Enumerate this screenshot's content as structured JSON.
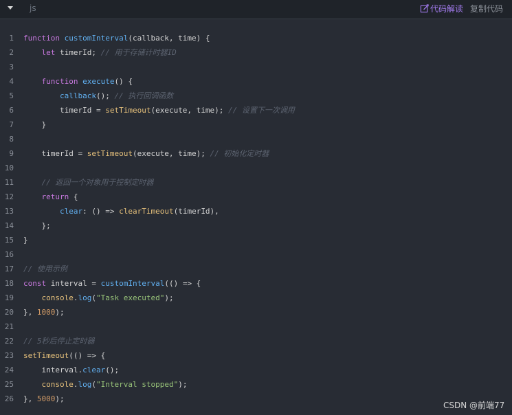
{
  "header": {
    "lang": "js",
    "explain_label": "代码解读",
    "copy_label": "复制代码",
    "icons": {
      "collapse": "caret-down-icon",
      "explain": "edit-icon"
    },
    "colors": {
      "accent": "#a47cf0",
      "background": "#282c34"
    }
  },
  "code": {
    "lines": [
      {
        "n": "1",
        "tokens": [
          [
            "kw",
            "function "
          ],
          [
            "fn",
            "customInterval"
          ],
          [
            "pl",
            "(callback, time) {"
          ]
        ]
      },
      {
        "n": "2",
        "tokens": [
          [
            "pl",
            "    "
          ],
          [
            "kw",
            "let "
          ],
          [
            "pl",
            "timerId; "
          ],
          [
            "cm",
            "// 用于存储计时器ID"
          ]
        ]
      },
      {
        "n": "3",
        "tokens": []
      },
      {
        "n": "4",
        "tokens": [
          [
            "pl",
            "    "
          ],
          [
            "kw",
            "function "
          ],
          [
            "fn",
            "execute"
          ],
          [
            "pl",
            "() {"
          ]
        ]
      },
      {
        "n": "5",
        "tokens": [
          [
            "pl",
            "        "
          ],
          [
            "fn",
            "callback"
          ],
          [
            "pl",
            "(); "
          ],
          [
            "cm",
            "// 执行回调函数"
          ]
        ]
      },
      {
        "n": "6",
        "tokens": [
          [
            "pl",
            "        timerId = "
          ],
          [
            "call",
            "setTimeout"
          ],
          [
            "pl",
            "(execute, time); "
          ],
          [
            "cm",
            "// 设置下一次调用"
          ]
        ]
      },
      {
        "n": "7",
        "tokens": [
          [
            "pl",
            "    }"
          ]
        ]
      },
      {
        "n": "8",
        "tokens": []
      },
      {
        "n": "9",
        "tokens": [
          [
            "pl",
            "    timerId = "
          ],
          [
            "call",
            "setTimeout"
          ],
          [
            "pl",
            "(execute, time); "
          ],
          [
            "cm",
            "// 初始化定时器"
          ]
        ]
      },
      {
        "n": "10",
        "tokens": []
      },
      {
        "n": "11",
        "tokens": [
          [
            "pl",
            "    "
          ],
          [
            "cm",
            "// 返回一个对象用于控制定时器"
          ]
        ]
      },
      {
        "n": "12",
        "tokens": [
          [
            "pl",
            "    "
          ],
          [
            "kw",
            "return "
          ],
          [
            "pl",
            "{"
          ]
        ]
      },
      {
        "n": "13",
        "tokens": [
          [
            "pl",
            "        "
          ],
          [
            "fn",
            "clear"
          ],
          [
            "pl",
            ": () => "
          ],
          [
            "call",
            "clearTimeout"
          ],
          [
            "pl",
            "(timerId),"
          ]
        ]
      },
      {
        "n": "14",
        "tokens": [
          [
            "pl",
            "    };"
          ]
        ]
      },
      {
        "n": "15",
        "tokens": [
          [
            "pl",
            "}"
          ]
        ]
      },
      {
        "n": "16",
        "tokens": []
      },
      {
        "n": "17",
        "tokens": [
          [
            "cm",
            "// 使用示例"
          ]
        ]
      },
      {
        "n": "18",
        "tokens": [
          [
            "kw",
            "const "
          ],
          [
            "pl",
            "interval = "
          ],
          [
            "fn",
            "customInterval"
          ],
          [
            "pl",
            "(() => {"
          ]
        ]
      },
      {
        "n": "19",
        "tokens": [
          [
            "pl",
            "    "
          ],
          [
            "call",
            "console"
          ],
          [
            "pl",
            "."
          ],
          [
            "fn",
            "log"
          ],
          [
            "pl",
            "("
          ],
          [
            "str",
            "\"Task executed\""
          ],
          [
            "pl",
            ");"
          ]
        ]
      },
      {
        "n": "20",
        "tokens": [
          [
            "pl",
            "}, "
          ],
          [
            "num",
            "1000"
          ],
          [
            "pl",
            ");"
          ]
        ]
      },
      {
        "n": "21",
        "tokens": []
      },
      {
        "n": "22",
        "tokens": [
          [
            "cm",
            "// 5秒后停止定时器"
          ]
        ]
      },
      {
        "n": "23",
        "tokens": [
          [
            "call",
            "setTimeout"
          ],
          [
            "pl",
            "(() => {"
          ]
        ]
      },
      {
        "n": "24",
        "tokens": [
          [
            "pl",
            "    interval."
          ],
          [
            "fn",
            "clear"
          ],
          [
            "pl",
            "();"
          ]
        ]
      },
      {
        "n": "25",
        "tokens": [
          [
            "pl",
            "    "
          ],
          [
            "call",
            "console"
          ],
          [
            "pl",
            "."
          ],
          [
            "fn",
            "log"
          ],
          [
            "pl",
            "("
          ],
          [
            "str",
            "\"Interval stopped\""
          ],
          [
            "pl",
            ");"
          ]
        ]
      },
      {
        "n": "26",
        "tokens": [
          [
            "pl",
            "}, "
          ],
          [
            "num",
            "5000"
          ],
          [
            "pl",
            ");"
          ]
        ]
      }
    ]
  },
  "watermark": "CSDN @前端77"
}
